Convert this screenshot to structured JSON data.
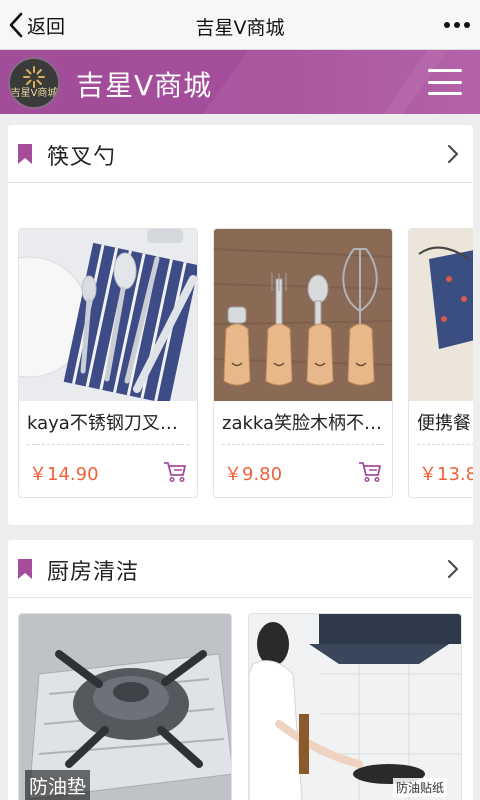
{
  "nav": {
    "back_label": "返回",
    "title": "吉星V商城"
  },
  "header": {
    "brand": "吉星V商城",
    "logo_text": "吉星V商城"
  },
  "sections": [
    {
      "title": "筷叉勺",
      "products": [
        {
          "name": "kaya不锈钢刀叉…",
          "price": "￥14.90"
        },
        {
          "name": "zakka笑脸木柄不…",
          "price": "￥9.80"
        },
        {
          "name": "便携餐",
          "price": "￥13.8"
        }
      ]
    },
    {
      "title": "厨房清洁",
      "items": [
        {
          "overlay": "防油垫"
        },
        {
          "overlay": "防油贴纸"
        }
      ]
    }
  ],
  "colors": {
    "accent": "#a24d9a",
    "price": "#f0613b",
    "bookmark": "#a54d9b"
  },
  "icons": [
    "chevron-left-icon",
    "more-icon",
    "menu-icon",
    "bookmark-icon",
    "chevron-right-icon",
    "cart-icon"
  ]
}
